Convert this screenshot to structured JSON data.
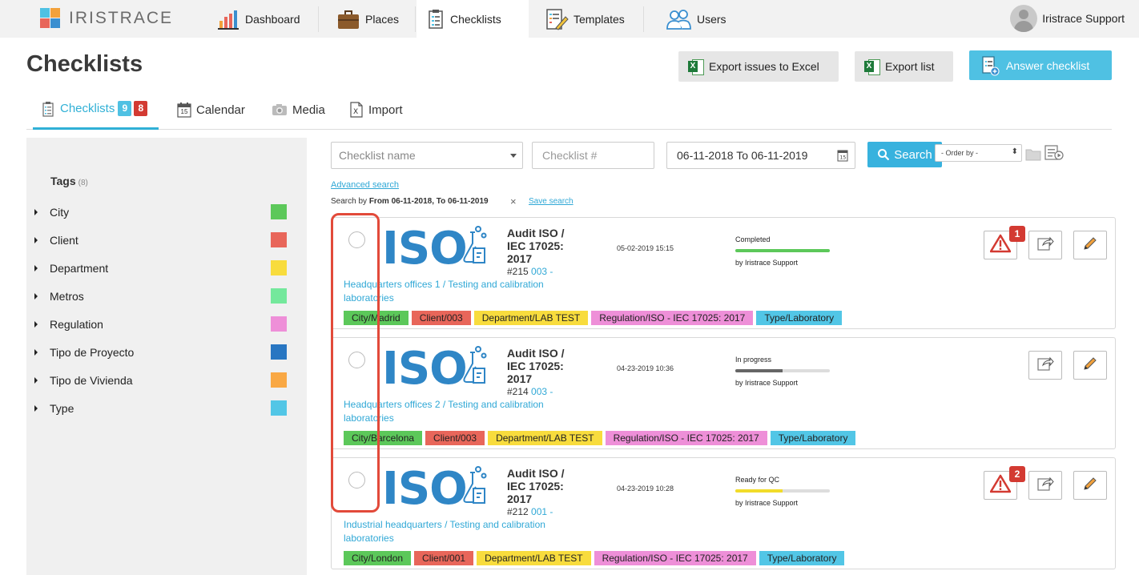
{
  "app": {
    "logo_text": "IRISTRACE"
  },
  "nav": {
    "tabs": [
      {
        "label": "Dashboard",
        "icon": "bar-chart-icon"
      },
      {
        "label": "Places",
        "icon": "briefcase-icon"
      },
      {
        "label": "Checklists",
        "icon": "clipboard-icon",
        "active": true
      },
      {
        "label": "Templates",
        "icon": "template-edit-icon"
      },
      {
        "label": "Users",
        "icon": "users-icon"
      }
    ],
    "user_name": "Iristrace Support"
  },
  "header": {
    "title": "Checklists",
    "export_issues_label": "Export issues to Excel",
    "export_list_label": "Export list",
    "answer_label": "Answer checklist"
  },
  "subtabs": {
    "checklists_label": "Checklists",
    "badge_blue": "9",
    "badge_red": "8",
    "calendar_label": "Calendar",
    "calendar_day": "15",
    "media_label": "Media",
    "import_label": "Import"
  },
  "sidebar": {
    "tags_title": "Tags",
    "tags_count": "(8)",
    "tags": [
      {
        "label": "City",
        "color": "#5cc85a"
      },
      {
        "label": "Client",
        "color": "#e8665a"
      },
      {
        "label": "Department",
        "color": "#f8dc3d"
      },
      {
        "label": "Metros",
        "color": "#74e89c"
      },
      {
        "label": "Regulation",
        "color": "#ee8fd8"
      },
      {
        "label": "Tipo de Proyecto",
        "color": "#2876c2"
      },
      {
        "label": "Tipo de Vivienda",
        "color": "#f9a844"
      },
      {
        "label": "Type",
        "color": "#52c6e6"
      }
    ]
  },
  "filters": {
    "name_placeholder": "Checklist name",
    "number_placeholder": "Checklist #",
    "date_range": "06-11-2018 To 06-11-2019",
    "search_label": "Search",
    "order_by": "- Order by -",
    "advanced_search": "Advanced search",
    "search_by_prefix": "Search by",
    "search_by_value": "From 06-11-2018, To 06-11-2019",
    "clear_symbol": "×",
    "save_search": "Save search"
  },
  "cards": [
    {
      "title": "Audit ISO / IEC 17025: 2017",
      "number": "#215",
      "code": "003 -",
      "place": "Headquarters offices 1 / Testing and calibration laboratories",
      "date": "05-02-2019 15:15",
      "status": "Completed",
      "progress": 1.0,
      "bar_color": "#5cc85a",
      "by": "by Iristrace Support",
      "issues": "1",
      "tags": [
        {
          "label": "City/Madrid",
          "color": "#5cc85a"
        },
        {
          "label": "Client/003",
          "color": "#e8665a"
        },
        {
          "label": "Department/LAB TEST",
          "color": "#f8dc3d"
        },
        {
          "label": "Regulation/ISO - IEC 17025: 2017",
          "color": "#ee8fd8"
        },
        {
          "label": "Type/Laboratory",
          "color": "#52c6e6"
        }
      ]
    },
    {
      "title": "Audit ISO / IEC 17025: 2017",
      "number": "#214",
      "code": "003 -",
      "place": "Headquarters offices 2 / Testing and calibration laboratories",
      "date": "04-23-2019 10:36",
      "status": "In progress",
      "progress": 0.5,
      "bar_color": "#666666",
      "by": "by Iristrace Support",
      "issues": null,
      "tags": [
        {
          "label": "City/Barcelona",
          "color": "#5cc85a"
        },
        {
          "label": "Client/003",
          "color": "#e8665a"
        },
        {
          "label": "Department/LAB TEST",
          "color": "#f8dc3d"
        },
        {
          "label": "Regulation/ISO - IEC 17025: 2017",
          "color": "#ee8fd8"
        },
        {
          "label": "Type/Laboratory",
          "color": "#52c6e6"
        }
      ]
    },
    {
      "title": "Audit ISO / IEC 17025: 2017",
      "number": "#212",
      "code": "001 -",
      "place": "Industrial headquarters / Testing and calibration laboratories",
      "date": "04-23-2019 10:28",
      "status": "Ready for QC",
      "progress": 0.5,
      "bar_color": "#f2dc2a",
      "by": "by Iristrace Support",
      "issues": "2",
      "tags": [
        {
          "label": "City/London",
          "color": "#5cc85a"
        },
        {
          "label": "Client/001",
          "color": "#e8665a"
        },
        {
          "label": "Department/LAB TEST",
          "color": "#f8dc3d"
        },
        {
          "label": "Regulation/ISO - IEC 17025: 2017",
          "color": "#ee8fd8"
        },
        {
          "label": "Type/Laboratory",
          "color": "#52c6e6"
        }
      ]
    }
  ],
  "colors": {
    "accent": "#30b0d6",
    "answer_button": "#4fc1e3",
    "badge_red": "#d33a32",
    "highlight": "#e24a3a"
  }
}
